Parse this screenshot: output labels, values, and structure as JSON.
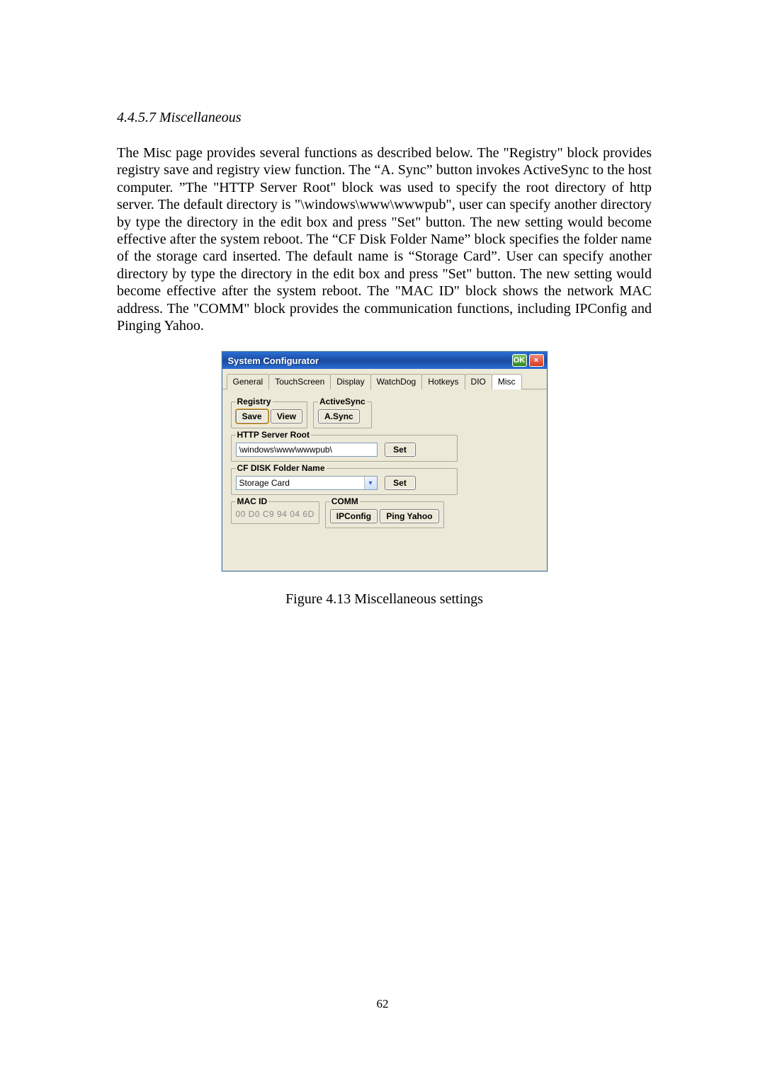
{
  "section_heading": "4.4.5.7 Miscellaneous",
  "body_text": "The Misc page provides several functions as described below. The \"Registry\" block provides registry save and registry view function. The “A. Sync” button invokes ActiveSync to the host computer. ”The \"HTTP Server Root\" block was used to specify the root directory of http server. The default directory is \"\\windows\\www\\wwwpub\", user can specify another directory by type the directory in the edit box and press \"Set\" button. The new setting would become effective after the system reboot. The “CF Disk Folder Name” block specifies the folder name of the storage card inserted. The default name is “Storage Card”. User can specify another directory by type the directory in the edit box and press \"Set\" button. The new setting would become effective after the system reboot. The \"MAC ID\" block shows the network MAC address. The \"COMM\" block provides the communication functions, including IPConfig and Pinging Yahoo.",
  "window": {
    "title": "System Configurator",
    "ok_label": "OK",
    "close_label": "×",
    "tabs": [
      {
        "label": "General"
      },
      {
        "label": "TouchScreen"
      },
      {
        "label": "Display"
      },
      {
        "label": "WatchDog"
      },
      {
        "label": "Hotkeys"
      },
      {
        "label": "DIO"
      },
      {
        "label": "Misc",
        "active": true
      }
    ],
    "registry": {
      "legend": "Registry",
      "save_label": "Save",
      "view_label": "View"
    },
    "activesync": {
      "legend": "ActiveSync",
      "async_label": "A.Sync"
    },
    "http_root": {
      "legend": "HTTP Server Root",
      "value": "\\windows\\www\\wwwpub\\",
      "set_label": "Set"
    },
    "cf_disk": {
      "legend": "CF DISK Folder Name",
      "value": "Storage Card",
      "set_label": "Set"
    },
    "mac": {
      "legend": "MAC ID",
      "value": "00 D0 C9 94 04 6D"
    },
    "comm": {
      "legend": "COMM",
      "ipconfig_label": "IPConfig",
      "ping_label": "Ping Yahoo"
    }
  },
  "figure_caption": "Figure 4.13 Miscellaneous settings",
  "page_number": "62"
}
